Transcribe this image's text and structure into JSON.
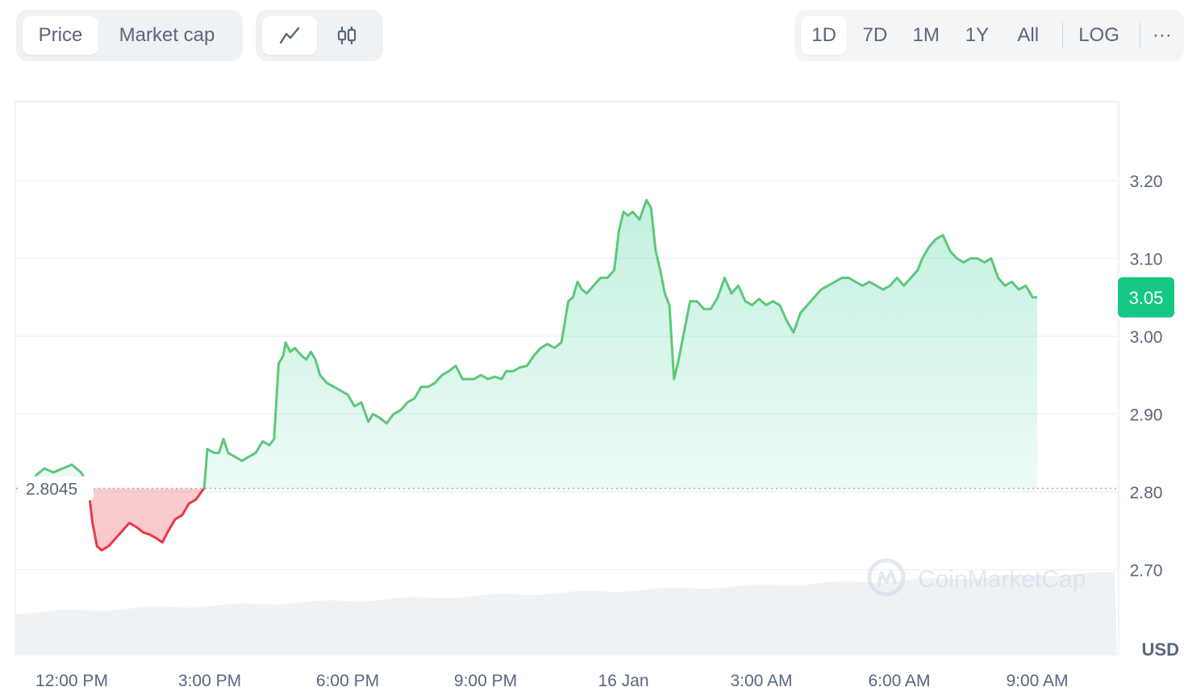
{
  "toolbar": {
    "type_tabs": [
      {
        "label": "Price",
        "active": true
      },
      {
        "label": "Market cap",
        "active": false
      }
    ],
    "style_icons": [
      {
        "icon": "line-chart-icon",
        "active": true
      },
      {
        "icon": "candlestick-icon",
        "active": false
      }
    ],
    "range_tabs": [
      {
        "label": "1D",
        "active": true
      },
      {
        "label": "7D",
        "active": false
      },
      {
        "label": "1M",
        "active": false
      },
      {
        "label": "1Y",
        "active": false
      },
      {
        "label": "All",
        "active": false
      }
    ],
    "log_label": "LOG",
    "more_label": "···"
  },
  "chart": {
    "watermark": "CoinMarketCap",
    "currency_label": "USD",
    "open_price_label": "2.8045",
    "current_price_label": "3.05",
    "colors": {
      "up": "#16c784",
      "up_line": "#5cc87a",
      "down": "#ea3943",
      "grid": "#eff2f5",
      "axis_text": "#58667e"
    }
  },
  "chart_data": {
    "type": "area",
    "baseline": 2.8045,
    "current": 3.05,
    "y_ticks": [
      2.7,
      2.8,
      2.9,
      3.0,
      3.1,
      3.2
    ],
    "y_tick_labels": [
      "2.70",
      "2.80",
      "2.90",
      "3.00",
      "3.10",
      "3.20"
    ],
    "ylim": [
      2.62,
      3.29
    ],
    "x_ticks": [
      {
        "label": "12:00 PM",
        "h": 0
      },
      {
        "label": "3:00 PM",
        "h": 3
      },
      {
        "label": "6:00 PM",
        "h": 6
      },
      {
        "label": "9:00 PM",
        "h": 9
      },
      {
        "label": "16 Jan",
        "h": 12
      },
      {
        "label": "3:00 AM",
        "h": 15
      },
      {
        "label": "6:00 AM",
        "h": 18
      },
      {
        "label": "9:00 AM",
        "h": 21
      }
    ],
    "price_series": [
      [
        -0.8,
        2.82
      ],
      [
        -0.6,
        2.83
      ],
      [
        -0.4,
        2.825
      ],
      [
        -0.2,
        2.83
      ],
      [
        0.0,
        2.835
      ],
      [
        0.2,
        2.825
      ],
      [
        0.35,
        2.81
      ],
      [
        0.45,
        2.76
      ],
      [
        0.55,
        2.73
      ],
      [
        0.65,
        2.725
      ],
      [
        0.8,
        2.73
      ],
      [
        0.95,
        2.74
      ],
      [
        1.1,
        2.75
      ],
      [
        1.25,
        2.76
      ],
      [
        1.4,
        2.755
      ],
      [
        1.55,
        2.748
      ],
      [
        1.7,
        2.745
      ],
      [
        1.85,
        2.74
      ],
      [
        1.97,
        2.735
      ],
      [
        2.1,
        2.75
      ],
      [
        2.25,
        2.765
      ],
      [
        2.4,
        2.77
      ],
      [
        2.55,
        2.785
      ],
      [
        2.7,
        2.79
      ],
      [
        2.82,
        2.8
      ],
      [
        2.88,
        2.805
      ],
      [
        2.95,
        2.855
      ],
      [
        3.1,
        2.85
      ],
      [
        3.2,
        2.85
      ],
      [
        3.3,
        2.868
      ],
      [
        3.4,
        2.85
      ],
      [
        3.55,
        2.845
      ],
      [
        3.7,
        2.84
      ],
      [
        3.85,
        2.845
      ],
      [
        4.0,
        2.85
      ],
      [
        4.15,
        2.865
      ],
      [
        4.3,
        2.86
      ],
      [
        4.4,
        2.868
      ],
      [
        4.5,
        2.965
      ],
      [
        4.6,
        2.975
      ],
      [
        4.65,
        2.992
      ],
      [
        4.75,
        2.98
      ],
      [
        4.85,
        2.985
      ],
      [
        5.0,
        2.975
      ],
      [
        5.1,
        2.97
      ],
      [
        5.2,
        2.98
      ],
      [
        5.3,
        2.97
      ],
      [
        5.4,
        2.95
      ],
      [
        5.55,
        2.94
      ],
      [
        5.7,
        2.935
      ],
      [
        5.85,
        2.93
      ],
      [
        6.0,
        2.925
      ],
      [
        6.15,
        2.91
      ],
      [
        6.3,
        2.915
      ],
      [
        6.45,
        2.89
      ],
      [
        6.55,
        2.9
      ],
      [
        6.7,
        2.895
      ],
      [
        6.85,
        2.888
      ],
      [
        7.0,
        2.9
      ],
      [
        7.15,
        2.905
      ],
      [
        7.3,
        2.915
      ],
      [
        7.45,
        2.92
      ],
      [
        7.6,
        2.935
      ],
      [
        7.75,
        2.935
      ],
      [
        7.9,
        2.94
      ],
      [
        8.05,
        2.95
      ],
      [
        8.2,
        2.955
      ],
      [
        8.35,
        2.962
      ],
      [
        8.5,
        2.945
      ],
      [
        8.6,
        2.945
      ],
      [
        8.75,
        2.945
      ],
      [
        8.9,
        2.95
      ],
      [
        9.05,
        2.945
      ],
      [
        9.2,
        2.948
      ],
      [
        9.35,
        2.945
      ],
      [
        9.45,
        2.955
      ],
      [
        9.6,
        2.955
      ],
      [
        9.75,
        2.96
      ],
      [
        9.9,
        2.962
      ],
      [
        10.05,
        2.975
      ],
      [
        10.2,
        2.985
      ],
      [
        10.35,
        2.99
      ],
      [
        10.5,
        2.985
      ],
      [
        10.65,
        2.992
      ],
      [
        10.8,
        3.045
      ],
      [
        10.9,
        3.05
      ],
      [
        11.0,
        3.07
      ],
      [
        11.1,
        3.06
      ],
      [
        11.2,
        3.055
      ],
      [
        11.35,
        3.065
      ],
      [
        11.5,
        3.075
      ],
      [
        11.65,
        3.075
      ],
      [
        11.8,
        3.085
      ],
      [
        11.9,
        3.135
      ],
      [
        12.0,
        3.16
      ],
      [
        12.1,
        3.155
      ],
      [
        12.2,
        3.16
      ],
      [
        12.35,
        3.15
      ],
      [
        12.5,
        3.175
      ],
      [
        12.6,
        3.165
      ],
      [
        12.7,
        3.11
      ],
      [
        12.8,
        3.085
      ],
      [
        12.9,
        3.055
      ],
      [
        13.0,
        3.04
      ],
      [
        13.1,
        2.945
      ],
      [
        13.2,
        2.97
      ],
      [
        13.3,
        3.0
      ],
      [
        13.45,
        3.045
      ],
      [
        13.6,
        3.045
      ],
      [
        13.75,
        3.035
      ],
      [
        13.9,
        3.035
      ],
      [
        14.05,
        3.05
      ],
      [
        14.2,
        3.075
      ],
      [
        14.35,
        3.055
      ],
      [
        14.5,
        3.065
      ],
      [
        14.65,
        3.045
      ],
      [
        14.8,
        3.04
      ],
      [
        14.95,
        3.048
      ],
      [
        15.1,
        3.04
      ],
      [
        15.25,
        3.045
      ],
      [
        15.4,
        3.04
      ],
      [
        15.55,
        3.02
      ],
      [
        15.7,
        3.005
      ],
      [
        15.85,
        3.03
      ],
      [
        16.0,
        3.04
      ],
      [
        16.15,
        3.05
      ],
      [
        16.3,
        3.06
      ],
      [
        16.45,
        3.065
      ],
      [
        16.6,
        3.07
      ],
      [
        16.75,
        3.075
      ],
      [
        16.9,
        3.075
      ],
      [
        17.05,
        3.07
      ],
      [
        17.2,
        3.065
      ],
      [
        17.35,
        3.07
      ],
      [
        17.5,
        3.065
      ],
      [
        17.65,
        3.06
      ],
      [
        17.8,
        3.065
      ],
      [
        17.95,
        3.075
      ],
      [
        18.1,
        3.065
      ],
      [
        18.25,
        3.075
      ],
      [
        18.4,
        3.085
      ],
      [
        18.5,
        3.1
      ],
      [
        18.65,
        3.115
      ],
      [
        18.8,
        3.125
      ],
      [
        18.95,
        3.13
      ],
      [
        19.1,
        3.11
      ],
      [
        19.25,
        3.1
      ],
      [
        19.4,
        3.095
      ],
      [
        19.55,
        3.1
      ],
      [
        19.7,
        3.1
      ],
      [
        19.85,
        3.095
      ],
      [
        20.0,
        3.1
      ],
      [
        20.15,
        3.075
      ],
      [
        20.3,
        3.065
      ],
      [
        20.45,
        3.07
      ],
      [
        20.6,
        3.06
      ],
      [
        20.75,
        3.065
      ],
      [
        20.9,
        3.05
      ],
      [
        21.0,
        3.05
      ]
    ]
  }
}
